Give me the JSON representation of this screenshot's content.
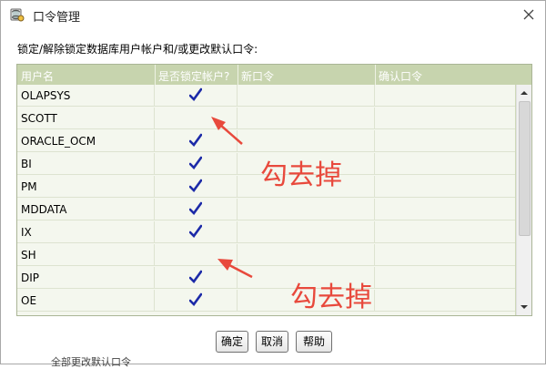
{
  "window": {
    "title": "口令管理"
  },
  "prompt": "锁定/解除锁定数据库用户帐户和/或更改默认口令:",
  "table": {
    "columns": [
      "用户名",
      "是否锁定帐户?",
      "新口令",
      "确认口令"
    ],
    "rows": [
      {
        "user": "OLAPSYS",
        "locked": true
      },
      {
        "user": "SCOTT",
        "locked": false
      },
      {
        "user": "ORACLE_OCM",
        "locked": true
      },
      {
        "user": "BI",
        "locked": true
      },
      {
        "user": "PM",
        "locked": true
      },
      {
        "user": "MDDATA",
        "locked": true
      },
      {
        "user": "IX",
        "locked": true
      },
      {
        "user": "SH",
        "locked": false
      },
      {
        "user": "DIP",
        "locked": true
      },
      {
        "user": "OE",
        "locked": true
      }
    ]
  },
  "annotations": [
    "勾去掉",
    "勾去掉"
  ],
  "buttons": {
    "ok": "确定",
    "cancel": "取消",
    "help": "帮助"
  },
  "background_text": "全部更改默认口令",
  "colors": {
    "header": "#c7d4ae",
    "check": "#1c2aa8",
    "annotation": "#e8493c"
  },
  "icons": {
    "app": "database-app-icon",
    "close": "close-icon",
    "check": "checkmark-icon"
  }
}
